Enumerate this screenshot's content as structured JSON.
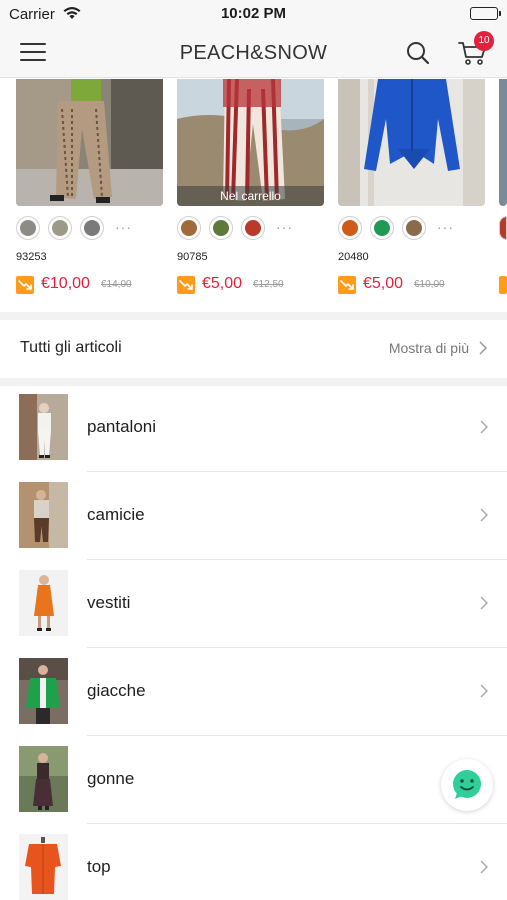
{
  "status_bar": {
    "carrier": "Carrier",
    "time": "10:02 PM"
  },
  "header": {
    "brand": "PEACH&SNOW",
    "cart_count": "10"
  },
  "products": [
    {
      "code": "93253",
      "price": "€10,00",
      "old_price": "€14,00",
      "in_cart": "",
      "swatch_colors": [
        "#8c8c84",
        "#9a9a86",
        "#7a7a7a"
      ],
      "more": "···"
    },
    {
      "code": "90785",
      "price": "€5,00",
      "old_price": "€12,50",
      "in_cart": "Nel carrello",
      "swatch_colors": [
        "#a06a3a",
        "#5d7a3c",
        "#b83a2a"
      ],
      "more": "···"
    },
    {
      "code": "20480",
      "price": "€5,00",
      "old_price": "€10,00",
      "in_cart": "",
      "swatch_colors": [
        "#d05a1a",
        "#1f9a55",
        "#8a6a4a"
      ],
      "more": "···"
    }
  ],
  "all_articles": {
    "title": "Tutti gli articoli",
    "more_label": "Mostra di più"
  },
  "categories": [
    {
      "label": "pantaloni"
    },
    {
      "label": "camicie"
    },
    {
      "label": "vestiti"
    },
    {
      "label": "giacche"
    },
    {
      "label": "gonne"
    },
    {
      "label": "top"
    }
  ],
  "colors": {
    "accent_red": "#e5203c",
    "trend_orange": "#ff9c1a",
    "chat_green": "#2fcf9a"
  },
  "icons": [
    "wifi-icon",
    "battery-icon",
    "menu-icon",
    "search-icon",
    "cart-icon",
    "trend-down-icon",
    "chevron-right-icon",
    "chat-icon"
  ]
}
